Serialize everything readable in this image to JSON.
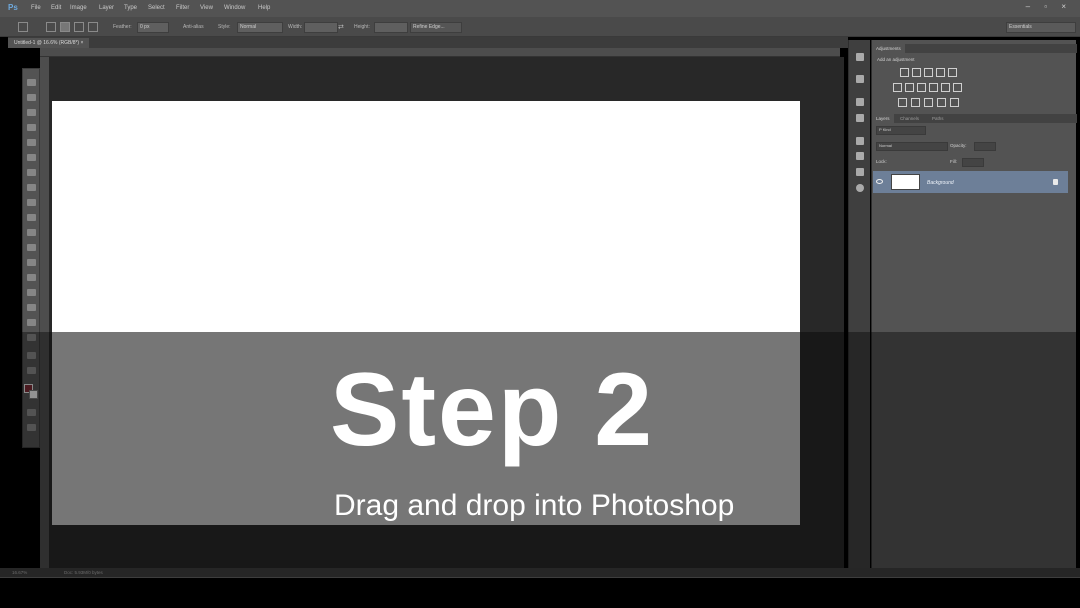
{
  "app": {
    "logo": "Ps",
    "menu": [
      "File",
      "Edit",
      "Image",
      "Layer",
      "Type",
      "Select",
      "Filter",
      "View",
      "Window",
      "Help"
    ],
    "window_controls": "– ▫ ×"
  },
  "options_bar": {
    "feather_label": "Feather:",
    "feather_value": "0 px",
    "anti_alias_label": "Anti-alias",
    "style_label": "Style:",
    "style_value": "Normal",
    "width_label": "Width:",
    "height_label": "Height:",
    "refine_edge_label": "Refine Edge...",
    "workspace_value": "Essentials"
  },
  "document": {
    "tab_label": "Untitled-1 @ 16.6% (RGB/8*) ×"
  },
  "panels": {
    "adjustments_tab": "Adjustments",
    "add_adjustment_label": "Add an adjustment",
    "layers_tabs": [
      "Layers",
      "Channels",
      "Paths"
    ],
    "kind_value": "P Kind",
    "blend_mode": "Normal",
    "opacity_label": "Opacity:",
    "lock_label": "Lock:",
    "fill_label": "Fill:",
    "layer_name": "Background"
  },
  "status": {
    "zoom": "16.67%",
    "doc_info": "Doc: 5.93M/0 bytes"
  },
  "overlay": {
    "title": "Step 2",
    "subtitle": "Drag and drop into Photoshop"
  },
  "colors": {
    "foreground": "#7a2a35",
    "background": "#ececec",
    "selected_layer": "#6d7f98"
  }
}
